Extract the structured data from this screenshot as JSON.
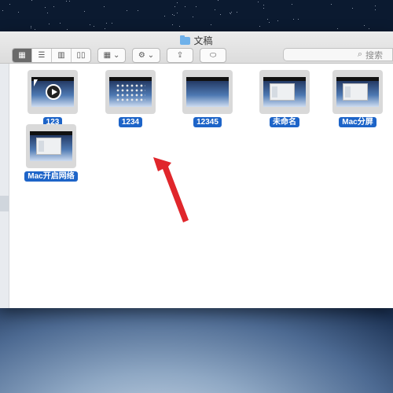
{
  "window": {
    "title": "文稿"
  },
  "toolbar": {
    "view_modes": [
      "icon-view",
      "list-view",
      "column-view",
      "cover-flow-view"
    ],
    "active_view": "icon-view",
    "group_button": "group-menu",
    "action_button": "gear-menu",
    "share_button": "share",
    "tag_button": "tag"
  },
  "search": {
    "placeholder": "搜索"
  },
  "files": [
    {
      "name": "123",
      "kind": "video"
    },
    {
      "name": "1234",
      "kind": "desktop-icons"
    },
    {
      "name": "12345",
      "kind": "desktop"
    },
    {
      "name": "未命名",
      "kind": "desktop-window"
    },
    {
      "name": "Mac分屏",
      "kind": "desktop-window"
    },
    {
      "name": "Mac开启网络",
      "kind": "desktop-window"
    }
  ],
  "colors": {
    "selection_label": "#1d64c8",
    "annotation_arrow": "#e0262b"
  }
}
